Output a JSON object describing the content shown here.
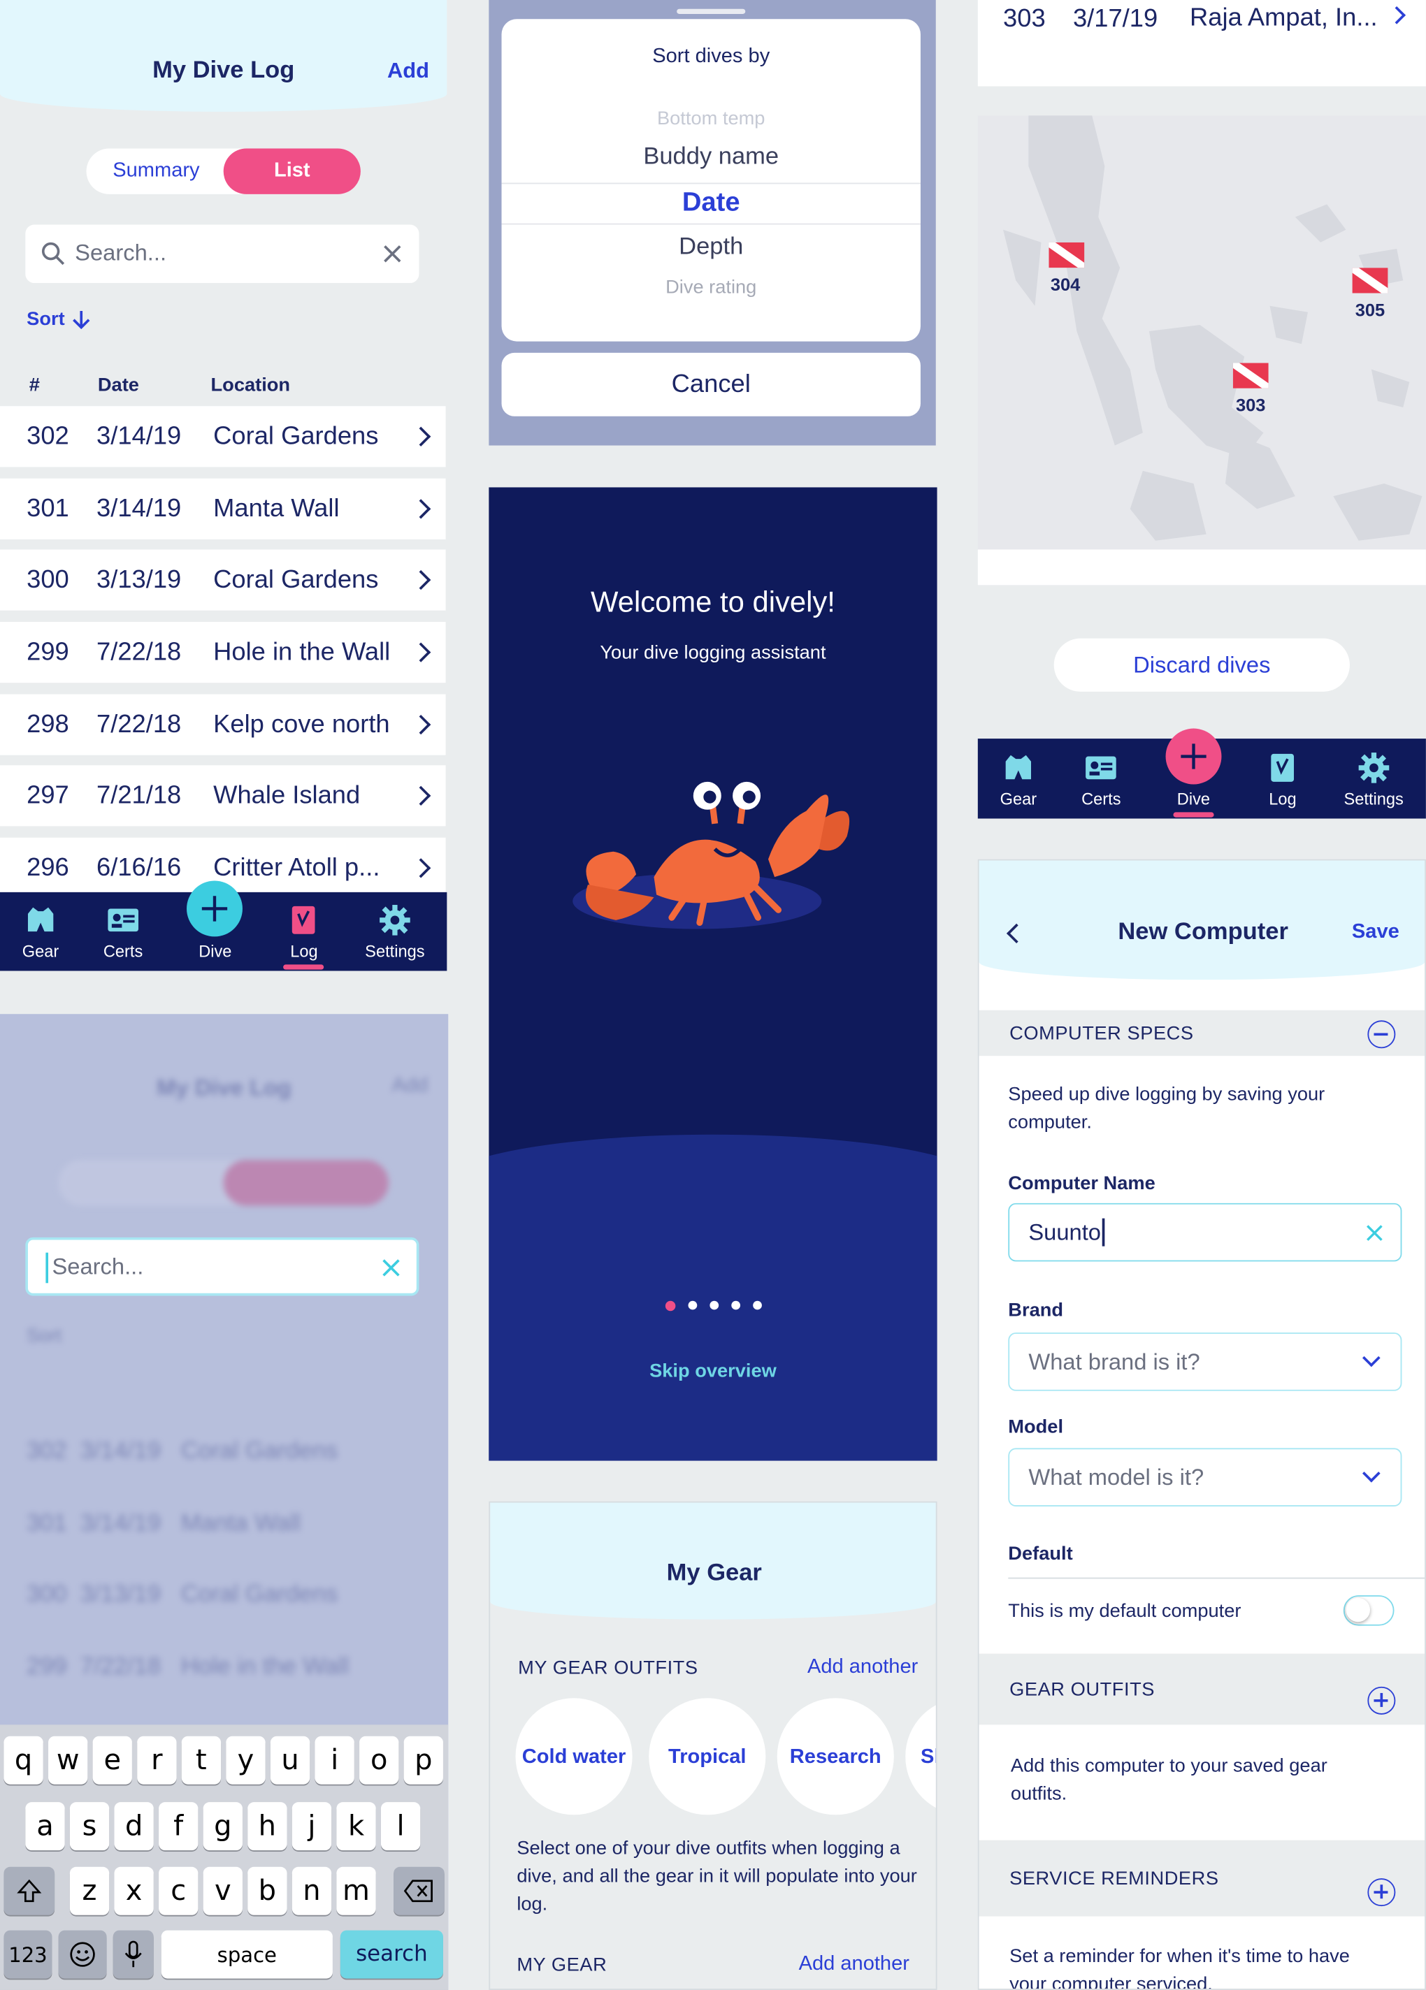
{
  "colors": {
    "navy": "#0f1a5b",
    "accent_blue": "#2b3fd6",
    "pink": "#f04f87",
    "aqua": "#3ccde0",
    "header_bg": "#e2f7fd",
    "panel_bg": "#eaedee",
    "crab": "#f26a3c"
  },
  "log": {
    "title": "My Dive Log",
    "add": "Add",
    "seg_summary": "Summary",
    "seg_list": "List",
    "search_placeholder": "Search...",
    "sort": "Sort",
    "col_num": "#",
    "col_date": "Date",
    "col_location": "Location",
    "rows": [
      {
        "num": "302",
        "date": "3/14/19",
        "loc": "Coral Gardens"
      },
      {
        "num": "301",
        "date": "3/14/19",
        "loc": "Manta Wall"
      },
      {
        "num": "300",
        "date": "3/13/19",
        "loc": "Coral Gardens"
      },
      {
        "num": "299",
        "date": "7/22/18",
        "loc": "Hole in the Wall"
      },
      {
        "num": "298",
        "date": "7/22/18",
        "loc": "Kelp cove north"
      },
      {
        "num": "297",
        "date": "7/21/18",
        "loc": "Whale Island"
      },
      {
        "num": "296",
        "date": "6/16/16",
        "loc": "Critter Atoll p..."
      }
    ]
  },
  "tabs": {
    "gear": "Gear",
    "certs": "Certs",
    "dive": "Dive",
    "log": "Log",
    "settings": "Settings"
  },
  "keyboard": {
    "row1": [
      "q",
      "w",
      "e",
      "r",
      "t",
      "y",
      "u",
      "i",
      "o",
      "p"
    ],
    "row2": [
      "a",
      "s",
      "d",
      "f",
      "g",
      "h",
      "j",
      "k",
      "l"
    ],
    "row3": [
      "z",
      "x",
      "c",
      "v",
      "b",
      "n",
      "m"
    ],
    "num": "123",
    "space": "space",
    "search": "search"
  },
  "sort": {
    "title": "Sort dives by",
    "options": [
      "Bottom temp",
      "Buddy name",
      "Date",
      "Depth",
      "Dive rating"
    ],
    "cancel": "Cancel"
  },
  "welcome": {
    "title": "Welcome to dively!",
    "subtitle": "Your dive logging assistant",
    "skip": "Skip overview",
    "pages": 5,
    "active_page": 1
  },
  "gear": {
    "title": "My Gear",
    "outfits_heading": "MY GEAR OUTFITS",
    "add_another": "Add another",
    "outfits": [
      "Cold water",
      "Tropical",
      "Research",
      "Sl"
    ],
    "outfits_desc": "Select one of your dive outfits when logging a dive, and all the gear in it will populate into your log.",
    "my_gear_heading": "MY GEAR",
    "add_another_2": "Add another"
  },
  "map": {
    "row_num": "303",
    "row_date": "3/17/19",
    "row_loc": "Raja Ampat, In...",
    "markers": [
      "304",
      "305",
      "303"
    ],
    "discard": "Discard dives"
  },
  "computer": {
    "title": "New Computer",
    "save": "Save",
    "specs_heading": "COMPUTER SPECS",
    "specs_desc": "Speed up dive logging by saving your computer.",
    "name_label": "Computer Name",
    "name_value": "Suunto",
    "brand_label": "Brand",
    "brand_placeholder": "What brand is it?",
    "model_label": "Model",
    "model_placeholder": "What model is it?",
    "default_label": "Default",
    "default_text": "This is my default computer",
    "default_on": false,
    "outfits_heading": "GEAR OUTFITS",
    "outfits_desc": "Add this computer to your saved gear outfits.",
    "service_heading": "SERVICE REMINDERS",
    "service_desc": "Set a reminder for when it's time to have your computer serviced."
  }
}
